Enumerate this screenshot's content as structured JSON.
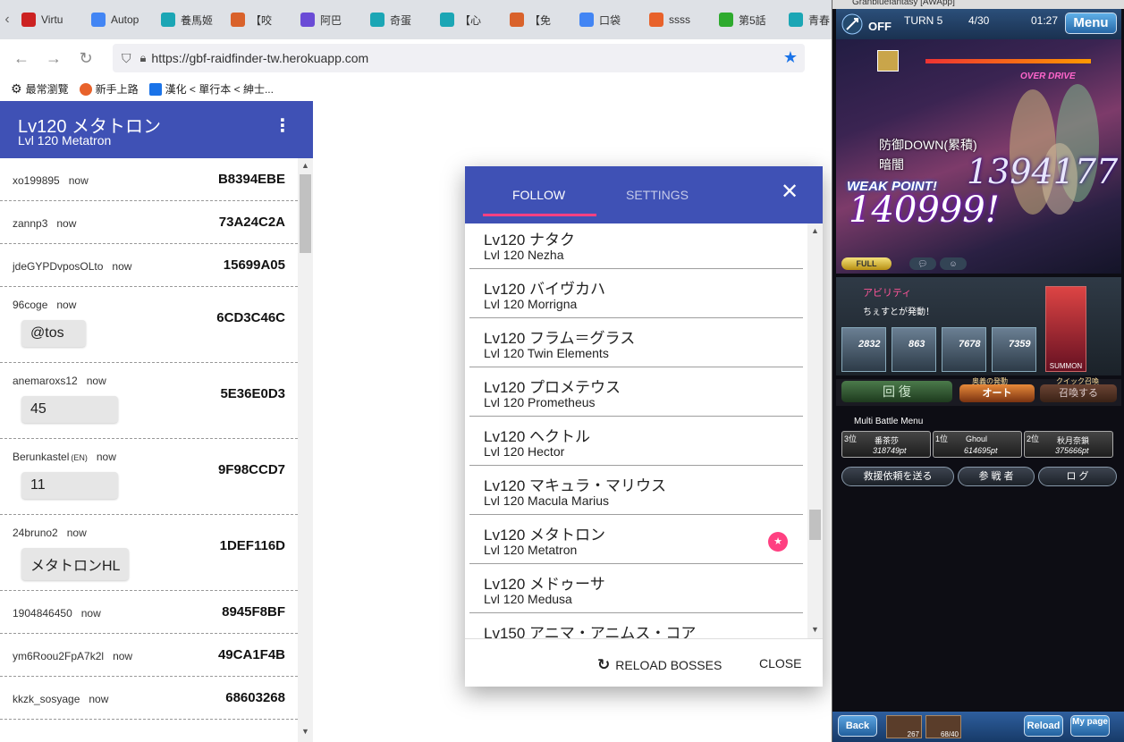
{
  "browser": {
    "tabs": [
      {
        "label": "Virtu",
        "icon": "eh-icon",
        "color": "#cc2222"
      },
      {
        "label": "Autop",
        "icon": "google-icon",
        "color": "#4285f4"
      },
      {
        "label": "養馬姬",
        "icon": "bookmark-site-icon",
        "color": "#1ba6b5"
      },
      {
        "label": "【咬",
        "icon": "site-icon",
        "color": "#d9622b"
      },
      {
        "label": "阿巴",
        "icon": "site-icon",
        "color": "#6a4bd6"
      },
      {
        "label": "奇蛋",
        "icon": "bookmark-site-icon",
        "color": "#1ba6b5"
      },
      {
        "label": "【心",
        "icon": "bookmark-site-icon",
        "color": "#1ba6b5"
      },
      {
        "label": "【免",
        "icon": "site-icon",
        "color": "#d9622b"
      },
      {
        "label": "口袋",
        "icon": "google-icon",
        "color": "#4285f4"
      },
      {
        "label": "ssss",
        "icon": "site-icon",
        "color": "#e8622b"
      },
      {
        "label": "第5話",
        "icon": "clover-icon",
        "color": "#2eaa2e"
      },
      {
        "label": "青春",
        "icon": "bookmark-site-icon",
        "color": "#1ba6b5"
      }
    ],
    "url": "https://gbf-raidfinder-tw.herokuapp.com",
    "bookmarks": [
      {
        "label": "最常瀏覽",
        "color": "#555555"
      },
      {
        "label": "新手上路",
        "color": "#e8622b"
      },
      {
        "label": "漢化 < 單行本 < 紳士...",
        "color": "#1a73e8"
      }
    ]
  },
  "app": {
    "title_jp": "Lv120 メタトロン",
    "title_en": "Lvl 120 Metatron",
    "menu_glyph": "⋮",
    "accent": "#3f51b5",
    "pink": "#ff4081",
    "feed": [
      {
        "user": "xo199895",
        "lang": "",
        "time": "now",
        "id": "B8394EBE",
        "message": ""
      },
      {
        "user": "zannp3",
        "lang": "",
        "time": "now",
        "id": "73A24C2A",
        "message": ""
      },
      {
        "user": "jdeGYPDvposOLto",
        "lang": "",
        "time": "now",
        "id": "15699A05",
        "message": ""
      },
      {
        "user": "96coge",
        "lang": "",
        "time": "now",
        "id": "6CD3C46C",
        "message": "@tos"
      },
      {
        "user": "anemaroxs12",
        "lang": "",
        "time": "now",
        "id": "5E36E0D3",
        "message": "45"
      },
      {
        "user": "Berunkastel",
        "lang": "(EN)",
        "time": "now",
        "id": "9F98CCD7",
        "message": "11"
      },
      {
        "user": "24bruno2",
        "lang": "",
        "time": "now",
        "id": "1DEF116D",
        "message": "メタトロンHL"
      },
      {
        "user": "1904846450",
        "lang": "",
        "time": "now",
        "id": "8945F8BF",
        "message": ""
      },
      {
        "user": "ym6Roou2FpA7k2l",
        "lang": "",
        "time": "now",
        "id": "49CA1F4B",
        "message": ""
      },
      {
        "user": "kkzk_sosyage",
        "lang": "",
        "time": "now",
        "id": "68603268",
        "message": ""
      }
    ]
  },
  "dialog": {
    "tab_follow": "FOLLOW",
    "tab_settings": "SETTINGS",
    "close_glyph": "✕",
    "bosses": [
      {
        "jp": "Lv120 ナタク",
        "en": "Lvl 120 Nezha",
        "followed": false
      },
      {
        "jp": "Lv120 バイヴカハ",
        "en": "Lvl 120 Morrigna",
        "followed": false
      },
      {
        "jp": "Lv120 フラム＝グラス",
        "en": "Lvl 120 Twin Elements",
        "followed": false
      },
      {
        "jp": "Lv120 プロメテウス",
        "en": "Lvl 120 Prometheus",
        "followed": false
      },
      {
        "jp": "Lv120 ヘクトル",
        "en": "Lvl 120 Hector",
        "followed": false
      },
      {
        "jp": "Lv120 マキュラ・マリウス",
        "en": "Lvl 120 Macula Marius",
        "followed": false
      },
      {
        "jp": "Lv120 メタトロン",
        "en": "Lvl 120 Metatron",
        "followed": true
      },
      {
        "jp": "Lv120 メドゥーサ",
        "en": "Lvl 120 Medusa",
        "followed": false
      },
      {
        "jp": "Lv150 アニマ・アニムス・コア",
        "en": "",
        "followed": false
      }
    ],
    "reload_label": "RELOAD BOSSES",
    "close_label": "CLOSE"
  },
  "game": {
    "window_title": "Granbluefantasy [AWApp]",
    "off_label": "OFF",
    "turn": "TURN 5",
    "count": "4/30",
    "clock": "01:27",
    "menu_label": "Menu",
    "overdrive": "OVER DRIVE",
    "debuff1": "防御DOWN(累積)",
    "debuff2": "暗闇",
    "weak_point": "WEAK POINT!",
    "damage_big": "1394177",
    "damage_main": "140999!",
    "full_label": "FULL",
    "ability_label": "アビリティ",
    "trigger_text": "ちぇすとが発動！",
    "party_values": [
      "2832",
      "863",
      "7678",
      "7359"
    ],
    "summon_label": "SUMMON",
    "heal_label": "回 復",
    "auto_caption": "奥義の発動",
    "auto_label": "オート",
    "summon_all_caption": "クイック召喚",
    "summon_all_label": "召喚する",
    "multi_title": "Multi Battle Menu",
    "multi_slots": [
      {
        "rank": "3位",
        "name": "番茶莎",
        "points": "318749pt"
      },
      {
        "rank": "1位",
        "name": "Ghoul",
        "points": "614695pt"
      },
      {
        "rank": "2位",
        "name": "秋月奈鎖",
        "points": "375666pt"
      }
    ],
    "rescue_label": "救援依頼を送る",
    "participants_label": "参 戦 者",
    "log_label": "ロ グ",
    "back_label": "Back",
    "slot1_value": "267",
    "slot2_value": "68/40",
    "reload_label": "Reload",
    "mypage_label": "My page"
  }
}
